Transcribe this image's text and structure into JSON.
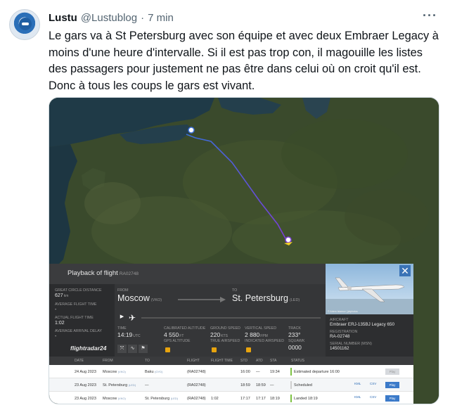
{
  "tweet": {
    "author_name": "Lustu",
    "author_handle": "@Lustublog",
    "separator": "·",
    "time_ago": "7 min",
    "more_label": "···",
    "text": "Le gars va à St Petersburg avec son équipe et avec deux Embraer Legacy à moins d'une heure d'intervalle. Si il est pas trop con, il magouille les listes des passagers pour justement ne pas être dans celui où on croit qu'il est. Donc à tous les coups le gars est vivant."
  },
  "panel": {
    "title": "Playback of flight",
    "registration_small": "RA02748",
    "close_label": "✕",
    "left": {
      "distance_label": "Great circle distance",
      "distance_value": "627",
      "distance_unit": "km",
      "avg_time_label": "Average flight time",
      "avg_time_value": "-",
      "actual_time_label": "Actual flight time",
      "actual_time_value": "1:02",
      "avg_delay_label": "Average arrival delay",
      "avg_delay_value": "-"
    },
    "route": {
      "from_label": "From",
      "from_city": "Moscow",
      "from_code": "(VKO)",
      "to_label": "To",
      "to_city": "St. Petersburg",
      "to_code": "(LED)",
      "time_label": "Time",
      "time_value": "14:19",
      "time_unit": "UTC",
      "alt_label": "Calibrated altitude",
      "alt_value": "4 550",
      "alt_unit": "FT",
      "gps_alt_label": "GPS altitude",
      "gs_label": "Ground speed",
      "gs_value": "220",
      "gs_unit": "KTS",
      "tas_label": "True airspeed",
      "vs_label": "Vertical speed",
      "vs_value": "2 880",
      "vs_unit": "FPM",
      "ias_label": "Indicated airspeed",
      "track_label": "Track",
      "track_value": "233°",
      "squawk_label": "Squawk",
      "squawk_value": "0000",
      "play_icon": "▶",
      "plane_icon": "✈"
    },
    "aircraft": {
      "photo_credit": "© Artem Islamov | jetphotos",
      "aircraft_label": "Aircraft",
      "aircraft_value": "Embraer ERJ-135BJ Legacy 650",
      "registration_label": "Registration",
      "registration_value": "RA-02748",
      "serial_label": "Serial number (MSN)",
      "serial_value": "14501162"
    },
    "brand": "flightradar24",
    "table": {
      "headers": [
        "Date",
        "From",
        "To",
        "Flight",
        "Flight time",
        "STD",
        "ATD",
        "STA",
        "Status"
      ],
      "rows": [
        {
          "date": "24 Aug 2023",
          "from": "Moscow",
          "from_code": "(VKO)",
          "to": "Baku",
          "to_code": "(GYD)",
          "flight": "(RA02748)",
          "flight_time": "",
          "std": "16:00",
          "atd": "—",
          "sta": "19:34",
          "status": "Estimated departure 16:00",
          "status_color": "#7dc243",
          "kml": "",
          "csv": "",
          "play": "Play",
          "play_enabled": false
        },
        {
          "date": "23 Aug 2023",
          "from": "St. Petersburg",
          "from_code": "(LED)",
          "to": "—",
          "to_code": "",
          "flight": "(RA02748)",
          "flight_time": "",
          "std": "18:59",
          "atd": "18:59",
          "sta": "—",
          "status": "Scheduled",
          "status_color": "#cfcfcf",
          "kml": "KML",
          "csv": "CSV",
          "play": "Play",
          "play_enabled": true
        },
        {
          "date": "23 Aug 2023",
          "from": "Moscow",
          "from_code": "(VKO)",
          "to": "St. Petersburg",
          "to_code": "(LED)",
          "flight": "(RA02748)",
          "flight_time": "1:02",
          "std": "17:17",
          "atd": "17:17",
          "sta": "18:19",
          "status": "Landed 18:19",
          "status_color": "#7dc243",
          "kml": "KML",
          "csv": "CSV",
          "play": "Play",
          "play_enabled": true
        }
      ]
    }
  },
  "colors": {
    "accent": "#3b7ac9",
    "track_start": "#3a6fd8",
    "track_end": "#7b3ed6",
    "flightradar_orange": "#f7a325"
  }
}
